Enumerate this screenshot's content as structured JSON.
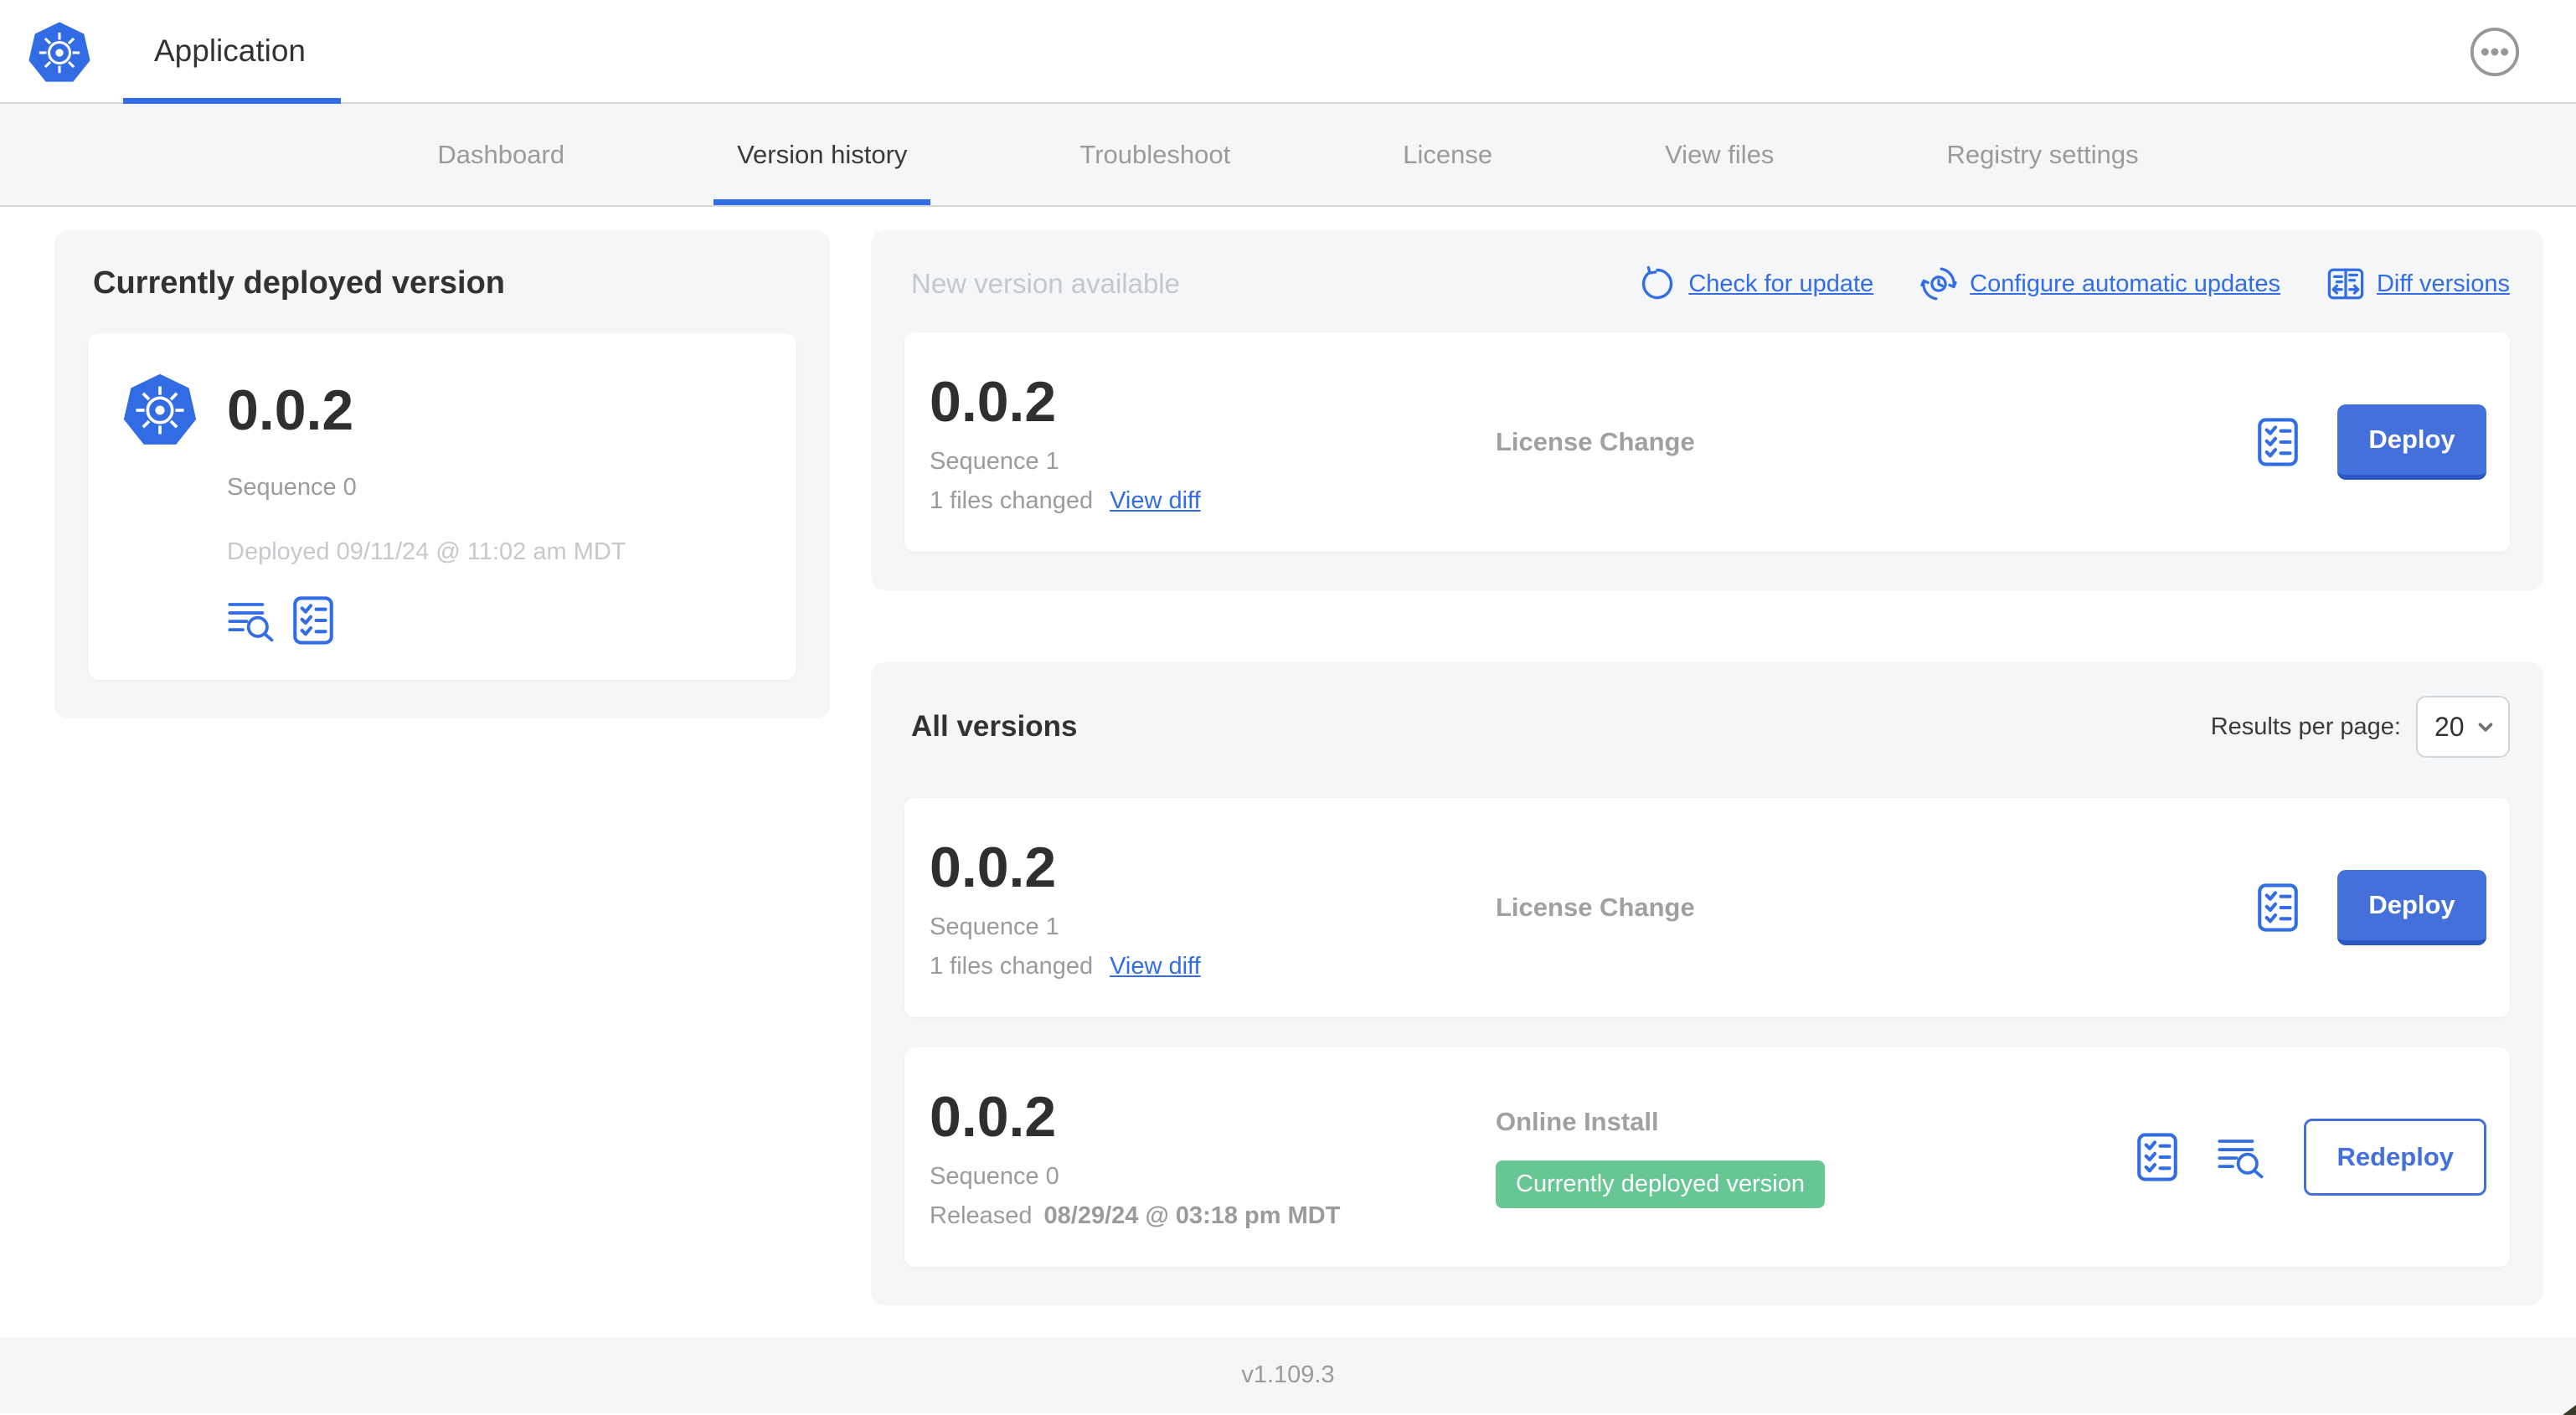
{
  "colors": {
    "accent_blue": "#326de6",
    "button_blue": "#4470dc",
    "button_blue_dark": "#2b57c2",
    "badge_green": "#66c694",
    "panel_bg": "#f5f6f8",
    "text_dark": "#323232",
    "text_gray": "#9b9b9b",
    "text_light_gray": "#c5c9cc"
  },
  "header": {
    "app_title": "Application",
    "menu_icon": "ellipsis-in-circle"
  },
  "nav": {
    "tabs": [
      {
        "label": "Dashboard",
        "active": false
      },
      {
        "label": "Version history",
        "active": true
      },
      {
        "label": "Troubleshoot",
        "active": false
      },
      {
        "label": "License",
        "active": false
      },
      {
        "label": "View files",
        "active": false
      },
      {
        "label": "Registry settings",
        "active": false
      }
    ]
  },
  "deployed_panel": {
    "title": "Currently deployed version",
    "app_icon": "kubernetes-logo",
    "version": "0.0.2",
    "sequence": "Sequence 0",
    "deployed_at": "Deployed 09/11/24 @ 11:02 am MDT",
    "icons": [
      "view-logs",
      "preflight-checks"
    ]
  },
  "new_version_panel": {
    "title": "New version available",
    "actions": [
      {
        "label": "Check for update",
        "icon": "refresh"
      },
      {
        "label": "Configure automatic updates",
        "icon": "scheduled-update"
      },
      {
        "label": "Diff versions",
        "icon": "diff"
      }
    ],
    "card": {
      "version": "0.0.2",
      "sequence": "Sequence 1",
      "files_changed": "1 files changed",
      "view_diff": "View diff",
      "source": "License Change",
      "action": "Deploy"
    }
  },
  "all_versions_panel": {
    "title": "All versions",
    "results_per_page_label": "Results per page:",
    "results_per_page": "20",
    "cards": [
      {
        "version": "0.0.2",
        "sequence": "Sequence 1",
        "files_changed": "1 files changed",
        "view_diff": "View diff",
        "source": "License Change",
        "action": "Deploy"
      },
      {
        "version": "0.0.2",
        "sequence": "Sequence 0",
        "released_prefix": "Released",
        "released_date": "08/29/24 @ 03:18 pm MDT",
        "source": "Online Install",
        "badge": "Currently deployed version",
        "action": "Redeploy"
      }
    ]
  },
  "footer": {
    "version_label": "v1.109.3"
  }
}
